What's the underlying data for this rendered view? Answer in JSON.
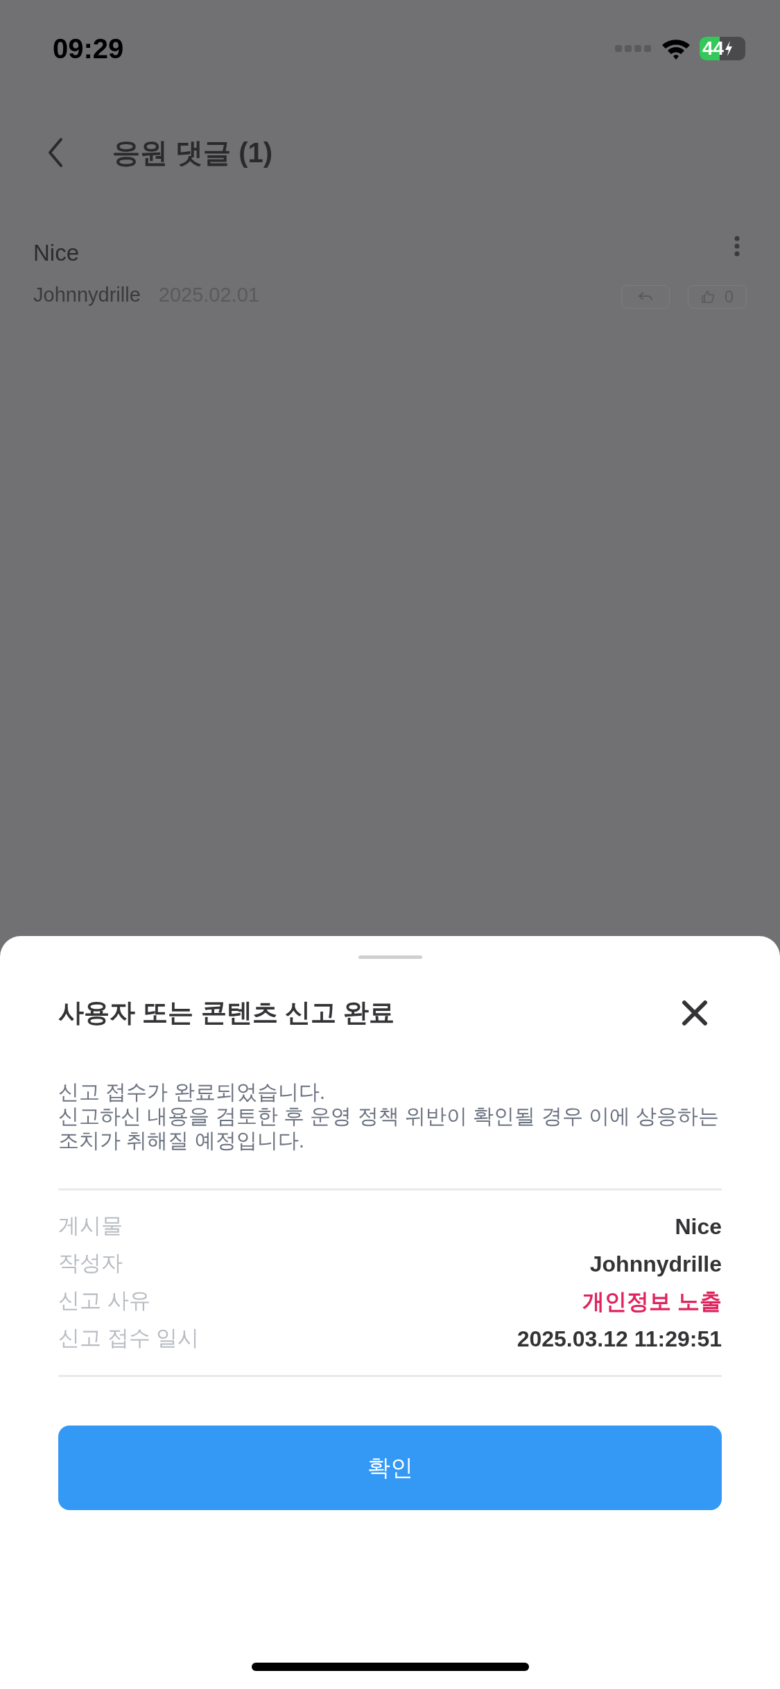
{
  "status_bar": {
    "time": "09:29",
    "battery": "44"
  },
  "header": {
    "title": "응원 댓글 (1)"
  },
  "comments": [
    {
      "text": "Nice",
      "author": "Johnnydrille",
      "date": "2025.02.01",
      "likes": "0"
    }
  ],
  "sheet": {
    "title": "사용자 또는 콘텐츠 신고 완료",
    "message": "신고 접수가 완료되었습니다.\n신고하신 내용을 검토한 후 운영 정책 위반이 확인될 경우 이에 상응하는 조치가 취해질 예정입니다.",
    "details": [
      {
        "label": "게시물",
        "value": "Nice",
        "kind": "plain"
      },
      {
        "label": "작성자",
        "value": "Johnnydrille",
        "kind": "plain"
      },
      {
        "label": "신고 사유",
        "value": "개인정보 노출",
        "kind": "alert"
      },
      {
        "label": "신고 접수 일시",
        "value": "2025.03.12 11:29:51",
        "kind": "plain"
      }
    ],
    "confirm": "확인"
  }
}
